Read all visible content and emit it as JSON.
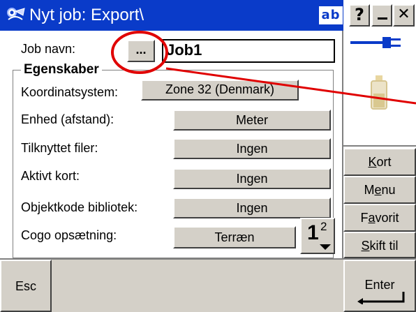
{
  "window": {
    "title": "Nyt job: Export\\",
    "ab_indicator": "ab",
    "help_btn": "?",
    "minimize_btn": "–",
    "close_btn": "✕"
  },
  "form": {
    "job_name_label": "Job navn:",
    "browse_button": "...",
    "job_name_value": "Job1",
    "group_title": "Egenskaber",
    "rows": [
      {
        "label": "Koordinatsystem:",
        "value": "Zone 32 (Denmark)"
      },
      {
        "label": "Enhed (afstand):",
        "value": "Meter"
      },
      {
        "label": "Tilknyttet filer:",
        "value": "Ingen"
      },
      {
        "label": "Aktivt kort:",
        "value": "Ingen"
      },
      {
        "label": "Objektkode bibliotek:",
        "value": "Ingen"
      },
      {
        "label": "Cogo opsætning:",
        "value": "Terræn"
      }
    ],
    "page_indicator_num": "1",
    "page_indicator_den": "2"
  },
  "sidebar": {
    "kort_pre": "",
    "kort_mn": "K",
    "kort_post": "ort",
    "menu_pre": "M",
    "menu_mn": "e",
    "menu_post": "nu",
    "favorit_pre": "F",
    "favorit_mn": "a",
    "favorit_post": "vorit",
    "skift_pre": "",
    "skift_mn": "S",
    "skift_post": "kift til"
  },
  "bottom": {
    "esc": "Esc",
    "enter": "Enter"
  },
  "colors": {
    "title_blue": "#0a3bc9",
    "annotation_red": "#e00000",
    "face": "#d4d0c8"
  }
}
